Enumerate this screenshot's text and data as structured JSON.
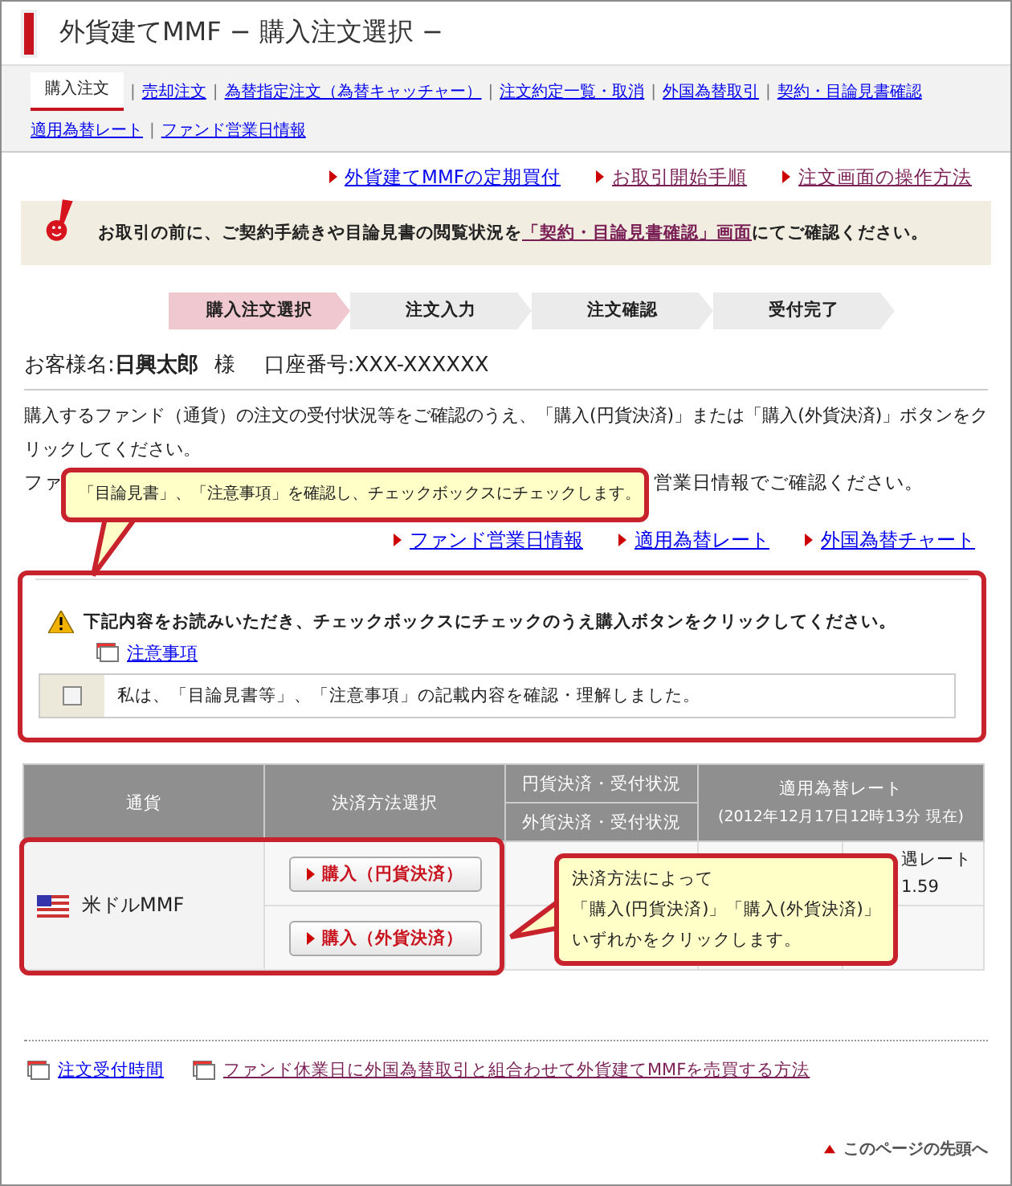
{
  "page_title": "外貨建てMMF − 購入注文選択 −",
  "nav_rows": [
    [
      {
        "label": "購入注文",
        "selected": true
      },
      {
        "sep": "|",
        "label": "売却注文",
        "selected": false
      },
      {
        "sep": "|",
        "label": "為替指定注文（為替キャッチャー）",
        "selected": false
      },
      {
        "sep": "|",
        "label": "注文約定一覧・取消",
        "selected": false
      },
      {
        "sep": "|",
        "label": "外国為替取引",
        "selected": false
      },
      {
        "sep": "|",
        "label": "契約・目論見書確認",
        "selected": false
      }
    ],
    [
      {
        "label": "適用為替レート",
        "selected": false
      },
      {
        "sep": "|",
        "label": "ファンド営業日情報",
        "selected": false
      }
    ]
  ],
  "top_links": [
    {
      "label": "外貨建てMMFの定期買付",
      "visited": false
    },
    {
      "label": "お取引開始手順",
      "visited": true
    },
    {
      "label": "注文画面の操作方法",
      "visited": true
    }
  ],
  "notice": {
    "before": "お取引の前に、ご契約手続きや目論見書の閲覧状況を",
    "link": "「契約・目論見書確認」画面",
    "after": "にてご確認ください。"
  },
  "steps": [
    {
      "label": "購入注文選択",
      "selected": true
    },
    {
      "label": "注文入力",
      "selected": false
    },
    {
      "label": "注文確認",
      "selected": false
    },
    {
      "label": "受付完了",
      "selected": false
    }
  ],
  "customer": {
    "name_label": "お客様名:",
    "name": "日興太郎",
    "honorific": "様",
    "account_label": "口座番号:",
    "account": "XXX-XXXXXX"
  },
  "intro": {
    "text": "購入するファンド（通貨）の注文の受付状況等をご確認のうえ、「購入(円貨決済)」または「購入(外貨決済)」ボタンをクリックしてください。",
    "partial_start": "ファ",
    "partial_end": "営業日情報でご確認ください。"
  },
  "info_links": [
    "ファンド営業日情報",
    "適用為替レート",
    "外国為替チャート"
  ],
  "confirm": {
    "message": "下記内容をお読みいただき、チェックボックスにチェックのうえ購入ボタンをクリックしてください。",
    "link": "注意事項",
    "checkbox_label": "私は、「目論見書等」、「注意事項」の記載内容を確認・理解しました。",
    "checked": false
  },
  "table": {
    "columns": [
      "通貨",
      "決済方法選択",
      "円貨決済・受付状況",
      "外貨決済・受付状況",
      "適用為替レート"
    ],
    "rate_timestamp": "(2012年12月17日12時13分 現在)",
    "rows": [
      {
        "currency": "米ドルMMF",
        "buttons": [
          "購入（円貨決済）",
          "購入（外貨決済）"
        ],
        "rate_label": "遇レート",
        "rate_value": "1.59"
      }
    ]
  },
  "callouts": [
    {
      "lines": [
        "「目論見書」、「注意事項」を確認し、チェックボックスにチェックします。"
      ]
    },
    {
      "lines": [
        "決済方法によって",
        "「購入(円貨決済)」「購入(外貨決済)」",
        "いずれかをクリックします。"
      ]
    }
  ],
  "footer_links": [
    {
      "label": "注文受付時間",
      "visited": false
    },
    {
      "label": "ファンド休業日に外国為替取引と組合わせて外貨建てMMFを売買する方法",
      "visited": true
    }
  ],
  "page_top": "このページの先頭へ"
}
